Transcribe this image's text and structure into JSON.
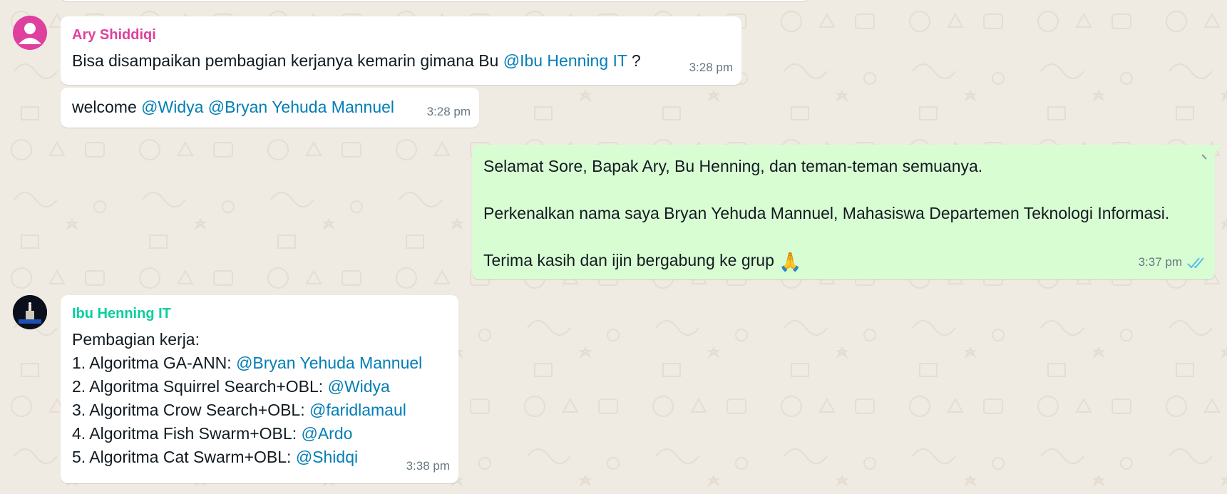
{
  "colors": {
    "background": "#efeae2",
    "incoming_bubble": "#ffffff",
    "outgoing_bubble": "#d9fdd3",
    "mention": "#027eb5",
    "timestamp": "#667781",
    "sender_ary": "#df3f9d",
    "sender_henning": "#06cf9c",
    "read_ticks": "#53bdeb"
  },
  "messages": [
    {
      "sender": "Ary Shiddiqi",
      "text_before": "Bisa disampaikan pembagian kerjanya kemarin gimana Bu ",
      "mention": "@Ibu Henning IT",
      "text_after": " ?",
      "time": "3:28 pm"
    },
    {
      "text_before": "welcome ",
      "mentions": [
        "@Widya",
        "@Bryan Yehuda Mannuel"
      ],
      "time": "3:28 pm"
    },
    {
      "outgoing": true,
      "lines": [
        "Selamat Sore, Bapak Ary, Bu Henning, dan teman-teman semuanya.",
        "Perkenalkan nama saya Bryan Yehuda Mannuel, Mahasiswa Departemen Teknologi Informasi.",
        "Terima kasih dan ijin bergabung ke grup"
      ],
      "emoji": "🙏",
      "time": "3:37 pm",
      "status_icon": "double-check-read-icon"
    },
    {
      "sender": "Ibu Henning IT",
      "intro": "Pembagian kerja:",
      "items": [
        {
          "label": "1. Algoritma GA-ANN: ",
          "mention": "@Bryan Yehuda Mannuel"
        },
        {
          "label": "2. Algoritma Squirrel Search+OBL: ",
          "mention": "@Widya"
        },
        {
          "label": "3. Algoritma Crow Search+OBL: ",
          "mention": "@faridlamaul"
        },
        {
          "label": "4. Algoritma Fish Swarm+OBL: ",
          "mention": "@Ardo"
        },
        {
          "label": "5. Algoritma Cat Swarm+OBL: ",
          "mention": "@Shidqi"
        }
      ],
      "time": "3:38 pm"
    }
  ]
}
